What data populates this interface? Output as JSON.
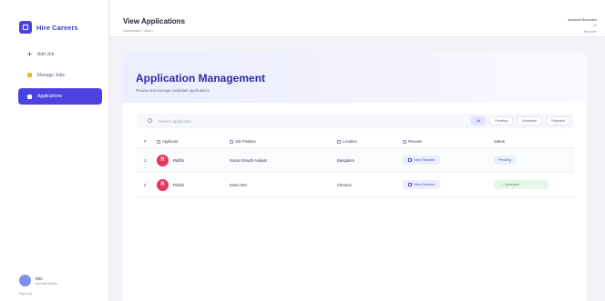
{
  "brand": {
    "name": "Hire Careers",
    "accent": "#4a43e0"
  },
  "sidebar": {
    "items": [
      {
        "label": "Add Job",
        "icon": "plus-icon"
      },
      {
        "label": "Manage Jobs",
        "icon": "folder-icon"
      },
      {
        "label": "Applications",
        "icon": "document-icon"
      }
    ],
    "user": {
      "name": "Riki",
      "email": "recruiter@hire"
    },
    "signout": "Sign out"
  },
  "topbar": {
    "title": "View Applications",
    "subtitle": "Dashboard / Jobs / ",
    "user_name": "Account Recruiter",
    "role": "Hr",
    "role_sub": "Recruiter"
  },
  "panel": {
    "title": "Application Management",
    "subtitle": "Review and manage candidate applications",
    "search_placeholder": "Search applicants...",
    "filters": [
      "All",
      "Pending",
      "Accepted",
      "Rejected"
    ]
  },
  "table": {
    "headers": [
      "#",
      "Applicant",
      "Job Position",
      "Location",
      "Resume",
      "Status"
    ],
    "rows": [
      {
        "index": "1",
        "initial": "R",
        "name": "Riddhi",
        "position": "Social Growth Analyst",
        "location": "Bangalore",
        "resume": "View Resume",
        "status": "Pending"
      },
      {
        "index": "2",
        "initial": "R",
        "name": "Riddhi",
        "position": "Intern Dev",
        "location": "Chennai",
        "resume": "View Resume",
        "status": "Accepted"
      }
    ]
  },
  "colors": {
    "accent": "#4a43e0",
    "avatar": "#e5355a",
    "pending": "#3a6cc4",
    "accepted": "#2f9a4f"
  }
}
